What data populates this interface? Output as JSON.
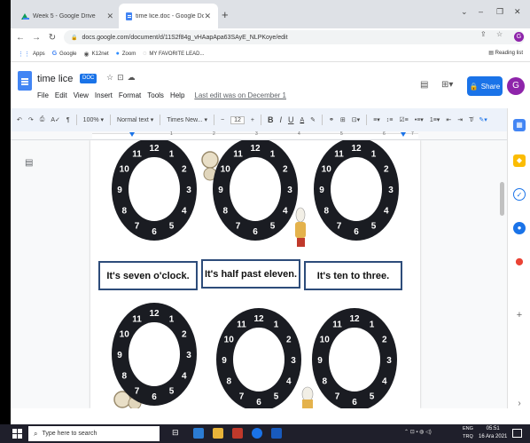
{
  "browser": {
    "tabs": [
      {
        "title": "Week 5 - Google Drive",
        "active": false
      },
      {
        "title": "time lice.doc - Google Docs",
        "active": true
      }
    ],
    "new_tab": "+",
    "window_controls": [
      "⌄",
      "–",
      "❐",
      "✕"
    ],
    "address": "docs.google.com/document/d/11S2f84g_vHAapApa63SAyE_NLPKoye/edit",
    "profile_initial": "G"
  },
  "bookmarks": {
    "items": [
      "Apps",
      "Google",
      "K12net",
      "Zoom",
      "MY FAVORITE LEAD..."
    ],
    "reading_list": "Reading list"
  },
  "doc": {
    "title": "time lice",
    "badge": "DOC",
    "menus": [
      "File",
      "Edit",
      "View",
      "Insert",
      "Format",
      "Tools",
      "Help"
    ],
    "last_edit": "Last edit was on December 1",
    "share_label": "Share",
    "avatar": "G"
  },
  "toolbar": {
    "zoom": "100%",
    "style": "Normal text",
    "font": "Times New...",
    "font_size": "12"
  },
  "ruler": {
    "numbers": [
      "1",
      "2",
      "3",
      "4",
      "5",
      "6",
      "7"
    ]
  },
  "content": {
    "clock_numbers": [
      "12",
      "1",
      "2",
      "3",
      "4",
      "5",
      "6",
      "7",
      "8",
      "9",
      "10",
      "11"
    ],
    "captions": [
      "It's seven o'clock.",
      "It's half past eleven.",
      "It's ten to three."
    ],
    "colors": {
      "clock_ring": "#1a1c22",
      "caption_border": "#2d4c7a",
      "accent": "#1a73e8"
    }
  },
  "taskbar": {
    "search_placeholder": "Type here to search",
    "lang": "ENG",
    "lang_sub": "TRQ",
    "time": "05:51",
    "date": "16 Ara 2021"
  }
}
